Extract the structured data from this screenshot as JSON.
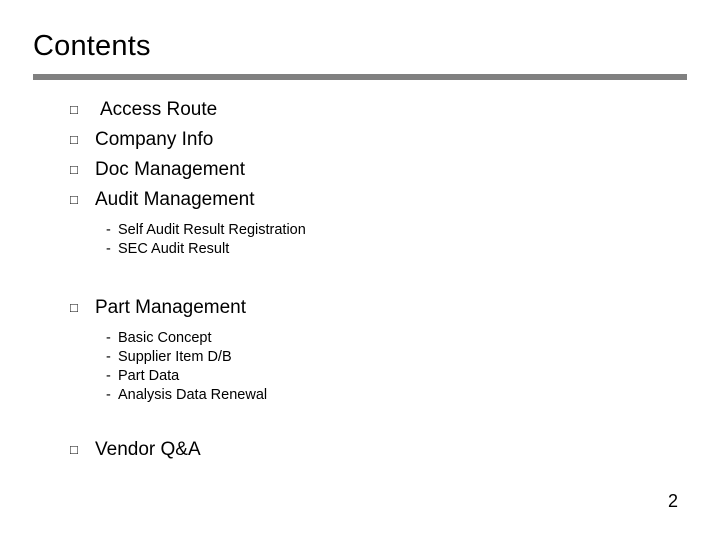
{
  "slide": {
    "title": "Contents",
    "page_number": "2",
    "bullet_glyph": "□",
    "dash_glyph": "-",
    "items": [
      {
        "label": "Access Route",
        "subs": []
      },
      {
        "label": "Company Info",
        "subs": []
      },
      {
        "label": "Doc Management",
        "subs": []
      },
      {
        "label": "Audit Management",
        "subs": [
          "Self Audit Result Registration",
          "SEC Audit Result"
        ]
      },
      {
        "label": "Part Management",
        "subs": [
          "Basic Concept",
          "Supplier Item D/B",
          "Part Data",
          "Analysis Data Renewal"
        ]
      },
      {
        "label": "Vendor Q&A",
        "subs": []
      }
    ]
  }
}
